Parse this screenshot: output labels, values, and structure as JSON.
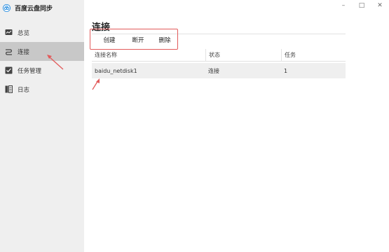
{
  "app": {
    "title": "百度云盘同步",
    "accent": "#2b8fe0"
  },
  "sidebar": {
    "items": [
      {
        "label": "总览",
        "icon": "overview-icon"
      },
      {
        "label": "连接",
        "icon": "connection-icon"
      },
      {
        "label": "任务管理",
        "icon": "task-icon"
      },
      {
        "label": "日志",
        "icon": "log-icon"
      }
    ],
    "active_index": 1
  },
  "main": {
    "title": "连接",
    "toolbar": {
      "create": "创建",
      "disconnect": "断开",
      "delete": "删除"
    },
    "table": {
      "columns": [
        "连接名称",
        "状态",
        "任务"
      ],
      "rows": [
        {
          "name": "baidu_netdisk1",
          "status": "连接",
          "tasks": "1"
        }
      ]
    }
  },
  "window": {
    "minimize": "–",
    "maximize": "□",
    "close": "✕"
  },
  "annotation_color": "#e25b5b"
}
